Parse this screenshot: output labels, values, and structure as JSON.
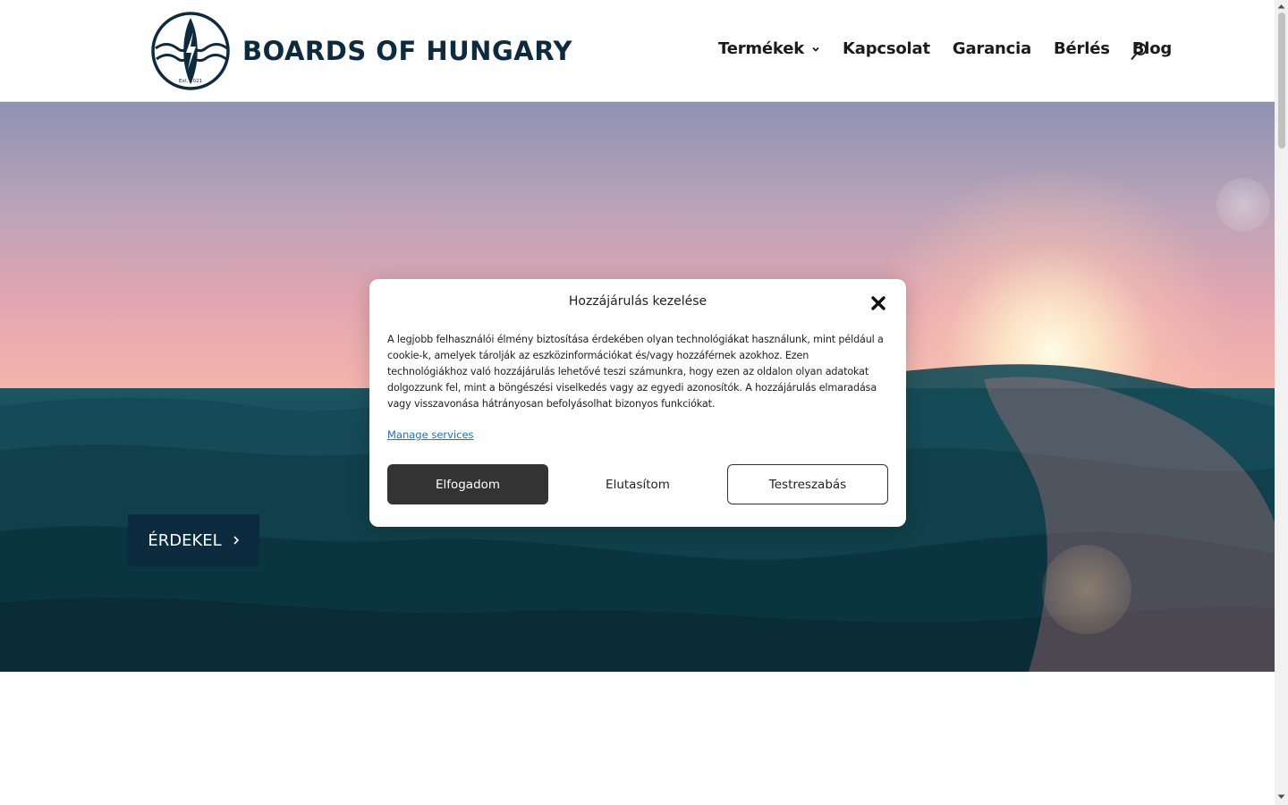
{
  "brand": {
    "name": "BOARDS OF HUNGARY",
    "est": "Est. 2021",
    "color": "#0d2b3e"
  },
  "nav": {
    "items": [
      {
        "label": "Termékek",
        "has_dropdown": true
      },
      {
        "label": "Kapcsolat",
        "has_dropdown": false
      },
      {
        "label": "Garancia",
        "has_dropdown": false
      },
      {
        "label": "Bérlés",
        "has_dropdown": false
      },
      {
        "label": "Blog",
        "has_dropdown": false
      }
    ],
    "search_icon": "search-icon"
  },
  "hero": {
    "cta_label": "ÉRDEKEL",
    "cta_icon": "chevron-right-icon",
    "cta_color": "#0c2b3f"
  },
  "consent": {
    "title": "Hozzájárulás kezelése",
    "body": "A legjobb felhasználói élmény biztosítása érdekében olyan technológiákat használunk, mint például a cookie-k, amelyek tárolják az eszközinformációkat és/vagy hozzáférnek azokhoz. Ezen technológiákhoz való hozzájárulás lehetővé teszi számunkra, hogy ezen az oldalon olyan adatokat dolgozzunk fel, mint a böngészési viselkedés vagy az egyedi azonosítók. A hozzájárulás elmaradása vagy visszavonása hátrányosan befolyásolhat bizonyos funkciókat.",
    "manage_link": "Manage services",
    "accept_label": "Elfogadom",
    "deny_label": "Elutasítom",
    "customize_label": "Testreszabás",
    "close_icon": "close-icon",
    "accept_color": "#333333",
    "link_color": "#1e73be"
  }
}
